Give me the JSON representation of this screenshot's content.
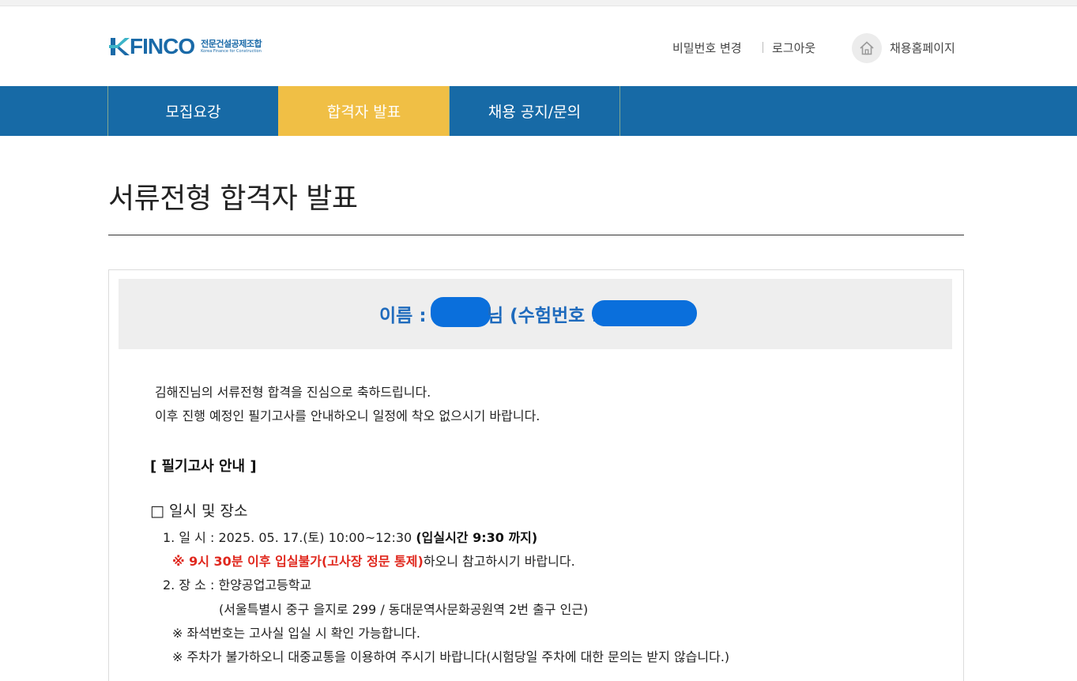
{
  "header": {
    "logo_text": "FINCO",
    "logo_sub_ko": "전문건설공제조합",
    "logo_sub_en": "Korea Finance for Construction",
    "change_password": "비밀번호 변경",
    "logout": "로그아웃",
    "home_label": "채용홈페이지",
    "home_icon": "home-icon"
  },
  "nav": {
    "items": [
      {
        "label": "모집요강",
        "active": false
      },
      {
        "label": "합격자 발표",
        "active": true
      },
      {
        "label": "채용 공지/문의",
        "active": false
      }
    ],
    "accent": "#f0bf45",
    "bar_color": "#176aa6"
  },
  "page": {
    "title": "서류전형 합격자 발표"
  },
  "result": {
    "name_prefix": "이름 :",
    "name_suffix": "님 (수험번호 :",
    "congrats_1": "김해진님의 서류전형 합격을 진심으로 축하드립니다.",
    "congrats_2": "이후 진행 예정인 필기고사를 안내하오니 일정에 착오 없으시기 바랍니다."
  },
  "exam": {
    "section_title": "[ 필기고사 안내 ]",
    "checkbox_title": "□ 일시 및 장소",
    "date_line": "1. 일 시 : 2025. 05. 17.(토) 10:00~12:30",
    "date_bold": "(입실시간 9:30 까지)",
    "warning_red": "※ 9시 30분 이후 입실불가(고사장 정문 통제)",
    "warning_rest": "하오니 참고하시기 바랍니다.",
    "place_line": "2. 장 소 : 한양공업고등학교",
    "address": "(서울특별시 중구 을지로 299 / 동대문역사문화공원역 2번 출구 인근)",
    "note_seat": "※ 좌석번호는 고사실 입실 시 확인 가능합니다.",
    "note_parking": "※ 주차가 불가하오니 대중교통을 이용하여 주시기 바랍니다(시험당일 주차에 대한 문의는 받지 않습니다.)"
  }
}
